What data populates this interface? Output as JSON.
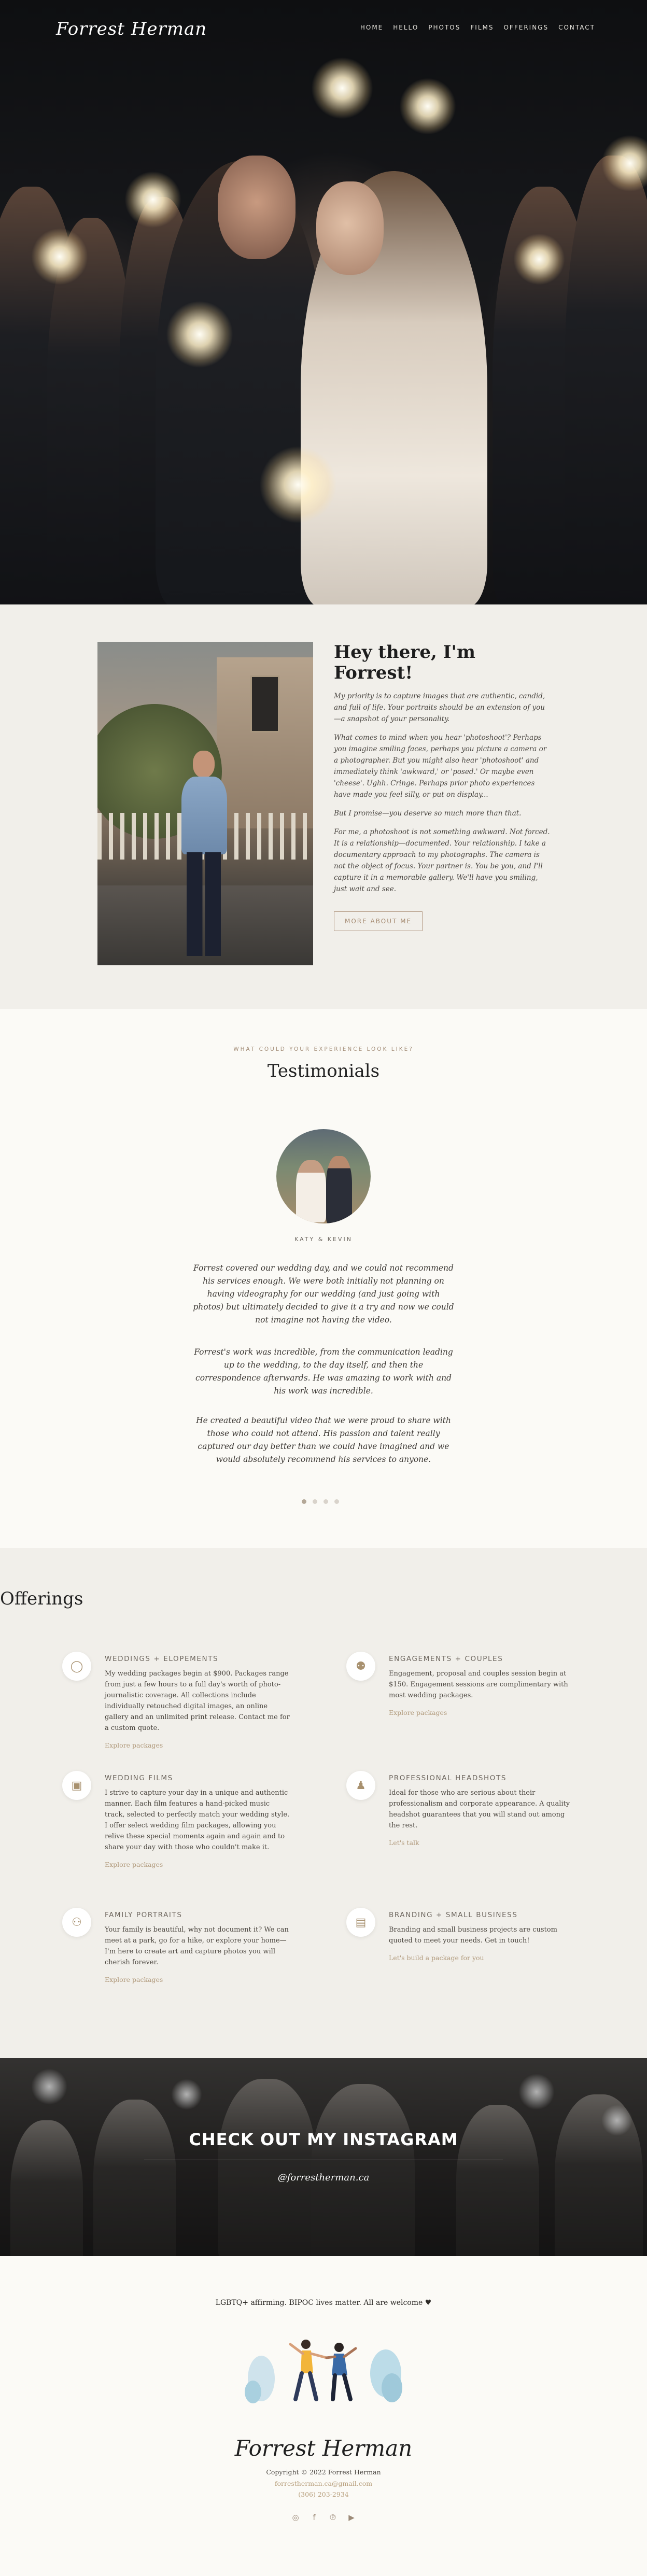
{
  "brand": {
    "logo": "Forrest Herman"
  },
  "nav": {
    "items": [
      "HOME",
      "HELLO",
      "PHOTOS",
      "FILMS",
      "OFFERINGS",
      "CONTACT"
    ]
  },
  "about": {
    "title": "Hey there, I'm Forrest!",
    "paragraphs": [
      "My priority is to capture images that are authentic, candid, and full of life. Your portraits should be an extension of you—a snapshot of your personality.",
      "What comes to mind when you hear 'photoshoot'? Perhaps you imagine smiling faces, perhaps you picture a camera or a photographer. But you might also hear 'photoshoot' and immediately think 'awkward,' or 'posed.' Or maybe even 'cheese'. Ughh. Cringe. Perhaps prior photo experiences have made you feel silly, or put on display...",
      "But I promise—you deserve so much more than that.",
      "For me, a photoshoot is not something awkward. Not forced. It is a relationship—documented. Your relationship. I take a documentary approach to my photographs. The camera is not the object of focus. Your partner is. You be you, and I'll capture it in a memorable gallery. We'll have you smiling, just wait and see."
    ],
    "button": "MORE ABOUT ME"
  },
  "testimonials": {
    "eyebrow": "WHAT COULD YOUR EXPERIENCE LOOK LIKE?",
    "title": "Testimonials",
    "couple": "KATY & KEVIN",
    "quotes": [
      "Forrest covered our wedding day, and we could not recommend his services enough. We were both initially not planning on having videography for our wedding (and just going with photos) but ultimately decided to give it a try and now we could not imagine not having the video.",
      "Forrest's work was incredible, from the communication leading up to the wedding, to the day itself, and then the correspondence afterwards. He was amazing to work with and his work was incredible.",
      "He created a beautiful video that we were proud to share with those who could not attend. His passion and talent really captured our day better than we could have imagined and we would absolutely recommend his services to anyone."
    ],
    "slide_count": 4,
    "active_slide": 1
  },
  "offerings": {
    "title": "Offerings",
    "items": [
      {
        "title": "WEDDINGS + ELOPEMENTS",
        "icon": "ring-icon",
        "glyph": "◯",
        "text": "My wedding packages begin at $900. Packages range from just a few hours to a full day's worth of photo-journalistic coverage. All collections include individually retouched digital images, an online gallery and an unlimited print release. Contact me for a custom quote.",
        "link": "Explore packages"
      },
      {
        "title": "ENGAGEMENTS + COUPLES",
        "icon": "couple-icon",
        "glyph": "⚉",
        "text": "Engagement, proposal and couples session begin at $150. Engagement sessions are complimentary with most wedding packages.",
        "link": "Explore packages"
      },
      {
        "title": "WEDDING FILMS",
        "icon": "film-icon",
        "glyph": "▣",
        "text": "I strive to capture your day in a unique and authentic manner. Each film features a hand-picked music track, selected to perfectly match your wedding style. I offer select wedding film packages, allowing you relive these special moments again and again and to share your day with those who couldn't make it.",
        "link": "Explore packages"
      },
      {
        "title": "PROFESSIONAL HEADSHOTS",
        "icon": "person-icon",
        "glyph": "♟",
        "text": "Ideal for those who are serious about their professionalism and corporate appearance. A quality headshot guarantees that you will stand out among the rest.",
        "link": "Let's talk"
      },
      {
        "title": "FAMILY PORTRAITS",
        "icon": "family-icon",
        "glyph": "⚇",
        "text": "Your family is beautiful, why not document it? We can meet at a park, go for a hike, or explore your home—I'm here to create art and capture photos you will cherish forever.",
        "link": "Explore packages"
      },
      {
        "title": "BRANDING + SMALL BUSINESS",
        "icon": "briefcase-icon",
        "glyph": "▤",
        "text": "Branding and small business projects are custom quoted to meet your needs. Get in touch!",
        "link": "Let's build a package for you"
      }
    ]
  },
  "instagram": {
    "title": "CHECK OUT MY INSTAGRAM",
    "handle": "@forrestherman.ca"
  },
  "footer": {
    "statement": "LGBTQ+ affirming. BIPOC lives matter. All are welcome ♥",
    "logo": "Forrest Herman",
    "copyright": "Copyright © 2022 Forrest Herman",
    "email": "forrestherman.ca@gmail.com",
    "phone": "(306) 203-2934",
    "socials": [
      {
        "icon": "instagram-icon",
        "glyph": "◎"
      },
      {
        "icon": "facebook-icon",
        "glyph": "f"
      },
      {
        "icon": "pinterest-icon",
        "glyph": "℗"
      },
      {
        "icon": "youtube-icon",
        "glyph": "▶"
      }
    ]
  },
  "colors": {
    "accent": "#a38d78",
    "bg_light": "#fbfaf6",
    "bg_muted": "#f1efea",
    "text": "#2b2b2b"
  }
}
